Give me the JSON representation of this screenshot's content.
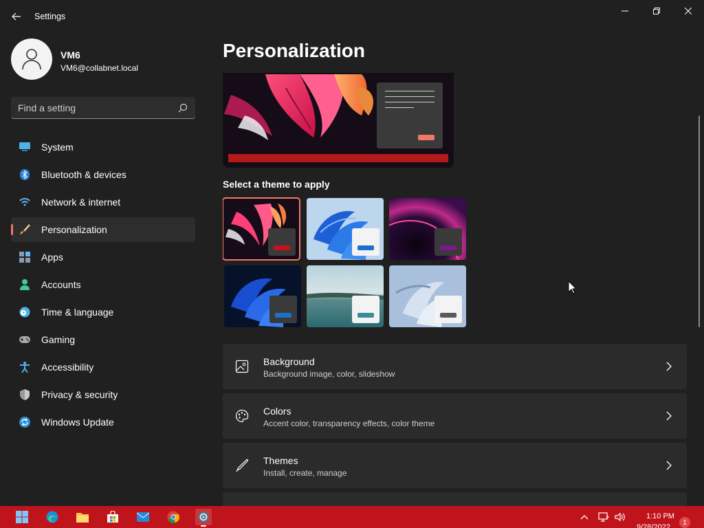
{
  "window": {
    "title": "Settings"
  },
  "profile": {
    "name": "VM6",
    "email": "VM6@collabnet.local"
  },
  "search": {
    "placeholder": "Find a setting"
  },
  "sidebar": {
    "items": [
      {
        "label": "System",
        "icon": "monitor-icon",
        "active": false
      },
      {
        "label": "Bluetooth & devices",
        "icon": "bluetooth-icon",
        "active": false
      },
      {
        "label": "Network & internet",
        "icon": "wifi-icon",
        "active": false
      },
      {
        "label": "Personalization",
        "icon": "brush-icon",
        "active": true
      },
      {
        "label": "Apps",
        "icon": "apps-icon",
        "active": false
      },
      {
        "label": "Accounts",
        "icon": "person-icon",
        "active": false
      },
      {
        "label": "Time & language",
        "icon": "globe-clock-icon",
        "active": false
      },
      {
        "label": "Gaming",
        "icon": "gamepad-icon",
        "active": false
      },
      {
        "label": "Accessibility",
        "icon": "accessibility-icon",
        "active": false
      },
      {
        "label": "Privacy & security",
        "icon": "shield-icon",
        "active": false
      },
      {
        "label": "Windows Update",
        "icon": "update-icon",
        "active": false
      }
    ]
  },
  "main": {
    "title": "Personalization",
    "theme_section_label": "Select a theme to apply",
    "themes": [
      {
        "name": "glow-red",
        "swatch": "#c8101e",
        "badge": "dark",
        "selected": true
      },
      {
        "name": "bloom-light",
        "swatch": "#1e6fc8",
        "badge": "light",
        "selected": false
      },
      {
        "name": "glow-purple",
        "swatch": "#7a1a8c",
        "badge": "dark",
        "selected": false
      },
      {
        "name": "bloom-dark",
        "swatch": "#1e6fc8",
        "badge": "dark",
        "selected": false
      },
      {
        "name": "captured-motion",
        "swatch": "#3a8c9a",
        "badge": "light",
        "selected": false
      },
      {
        "name": "flow",
        "swatch": "#5a5a5a",
        "badge": "light",
        "selected": false
      }
    ],
    "cards": [
      {
        "title": "Background",
        "subtitle": "Background image, color, slideshow",
        "icon": "image-icon"
      },
      {
        "title": "Colors",
        "subtitle": "Accent color, transparency effects, color theme",
        "icon": "palette-icon"
      },
      {
        "title": "Themes",
        "subtitle": "Install, create, manage",
        "icon": "pen-icon"
      }
    ]
  },
  "taskbar": {
    "time": "1:10 PM",
    "date": "9/28/2022",
    "notification_count": "1",
    "apps": [
      "start-icon",
      "edge-icon",
      "file-explorer-icon",
      "store-icon",
      "mail-icon",
      "chrome-icon",
      "settings-icon"
    ]
  },
  "colors": {
    "accent": "#f07868",
    "taskbar": "#c0141c",
    "background": "#202020",
    "card": "#2b2b2b"
  }
}
